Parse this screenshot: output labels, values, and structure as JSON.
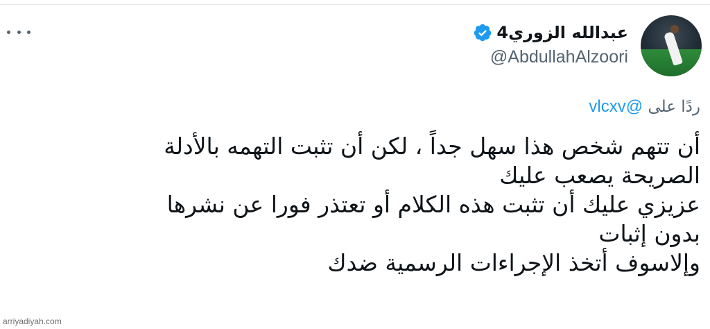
{
  "author": {
    "display_name": "عبدالله الزوري4",
    "handle": "@AbdullahAlzoori",
    "verified": true,
    "avatar": "avatar-photo"
  },
  "reply": {
    "prefix": "ردًا على",
    "mention": "@vlcxv"
  },
  "tweet": {
    "lines": [
      "أن تتهم شخص هذا سهل جداً ، لكن أن تثبت التهمه بالأدلة",
      "الصريحة يصعب عليك",
      "عزيزي عليك أن تثبت هذه الكلام أو تعتذر فورا عن نشرها",
      "بدون إثبات",
      "وإلاسوف أتخذ الإجراءات الرسمية ضدك"
    ]
  },
  "watermark": "arriyadiyah.com",
  "icons": {
    "more": "more-icon",
    "verified": "verified-badge-icon"
  },
  "colors": {
    "verified_blue": "#1d9bf0",
    "mention_blue": "#1d9bf0",
    "secondary_text": "#536471",
    "primary_text": "#0f1419"
  }
}
